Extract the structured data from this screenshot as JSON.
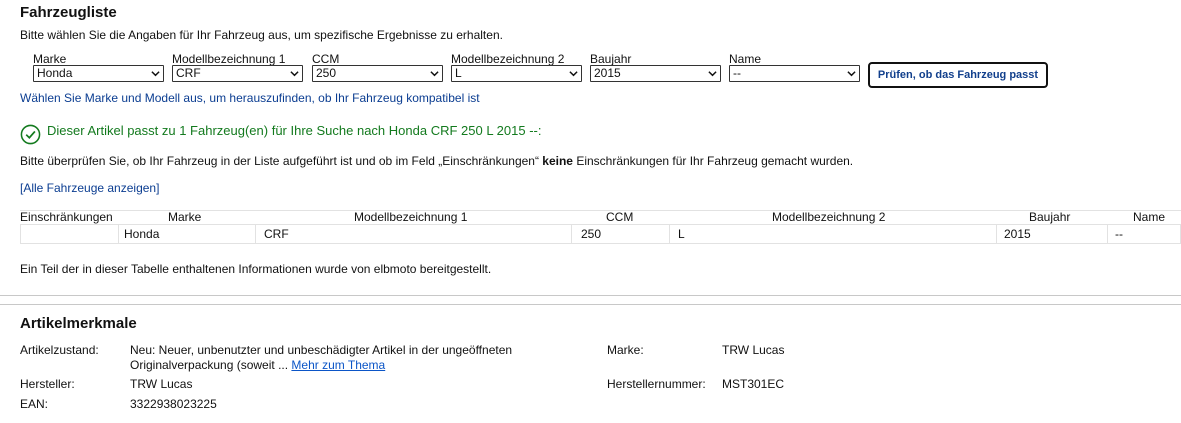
{
  "vehicle_list": {
    "title": "Fahrzeugliste",
    "intro": "Bitte wählen Sie die Angaben für Ihr Fahrzeug aus, um spezifische Ergebnisse zu erhalten.",
    "selectors": [
      {
        "label": "Marke",
        "value": "Honda"
      },
      {
        "label": "Modellbezeichnung 1",
        "value": "CRF"
      },
      {
        "label": "CCM",
        "value": "250"
      },
      {
        "label": "Modellbezeichnung 2",
        "value": "L"
      },
      {
        "label": "Baujahr",
        "value": "2015"
      },
      {
        "label": "Name",
        "value": "--"
      }
    ],
    "check_button": "Prüfen, ob das Fahrzeug passt",
    "hint": "Wählen Sie Marke und Modell aus, um herauszufinden, ob Ihr Fahrzeug kompatibel ist",
    "match_text": "Dieser Artikel passt zu 1 Fahrzeug(en) für Ihre Suche nach Honda CRF 250 L 2015 --:",
    "check_note_prefix": "Bitte überprüfen Sie, ob Ihr Fahrzeug in der Liste aufgeführt ist und ob im Feld „Einschränkungen“ ",
    "check_note_bold": "keine",
    "check_note_suffix": " Einschränkungen für Ihr Fahrzeug gemacht wurden.",
    "show_all_link": "[Alle Fahrzeuge anzeigen]",
    "table": {
      "headers": [
        "Einschränkungen",
        "Marke",
        "Modellbezeichnung 1",
        "CCM",
        "Modellbezeichnung 2",
        "Baujahr",
        "Name"
      ],
      "rows": [
        [
          "",
          "Honda",
          "CRF",
          "250",
          "L",
          "2015",
          "--"
        ]
      ]
    },
    "source_note": "Ein Teil der in dieser Tabelle enthaltenen Informationen wurde von elbmoto bereitgestellt.",
    "colors": {
      "link": "#0b3d91",
      "success": "#137a1e"
    },
    "icons": {
      "match": "check-circle-icon",
      "select": "chevron-down-icon"
    }
  },
  "item_specifics": {
    "title": "Artikelmerkmale",
    "condition_label": "Artikelzustand:",
    "condition_value_line1": "Neu: Neuer, unbenutzter und unbeschädigter Artikel in der ungeöffneten",
    "condition_value_line2": "Originalverpackung (soweit ... ",
    "condition_more_link": "Mehr zum Thema",
    "manufacturer_label": "Hersteller:",
    "manufacturer_value": "TRW Lucas",
    "ean_label": "EAN:",
    "ean_value": "3322938023225",
    "brand_label": "Marke:",
    "brand_value": "TRW Lucas",
    "mpn_label": "Herstellernummer:",
    "mpn_value": "MST301EC"
  }
}
